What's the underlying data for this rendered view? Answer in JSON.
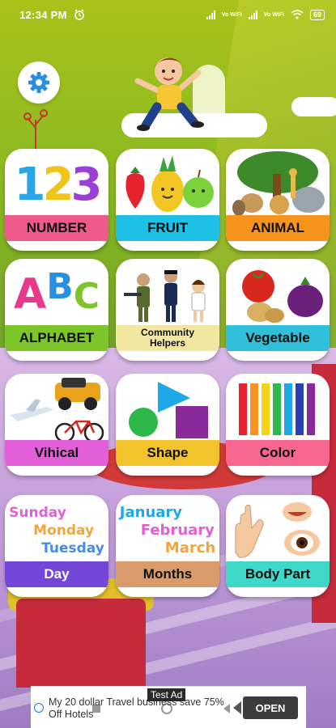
{
  "status_bar": {
    "time": "12:34 PM",
    "network_1": "Vo WiFi",
    "network_2": "Vo WiFi",
    "battery": "69"
  },
  "header": {
    "settings_icon": "gear-icon"
  },
  "categories": [
    {
      "label": "NUMBER",
      "art": "123",
      "color": "#f05a8a"
    },
    {
      "label": "FRUIT",
      "art": "fruits",
      "color": "#1ec0e6"
    },
    {
      "label": "ANIMAL",
      "art": "animals",
      "color": "#f7941d"
    },
    {
      "label": "ALPHABET",
      "art": "ABC",
      "color": "#7dc62a"
    },
    {
      "label": "Community Helpers",
      "label_line1": "Community",
      "label_line2": "Helpers",
      "art": "helpers",
      "color": "#f2e7a0"
    },
    {
      "label": "Vegetable",
      "art": "vegetables",
      "color": "#2fbfd8"
    },
    {
      "label": "Vihical",
      "art": "vehicles",
      "color": "#e25fd9"
    },
    {
      "label": "Shape",
      "art": "shapes",
      "color": "#f3c32c"
    },
    {
      "label": "Color",
      "art": "stripes",
      "color": "#f7668f"
    },
    {
      "label": "Day",
      "art": "days",
      "color": "#7345d8",
      "days": [
        "Sunday",
        "Monday",
        "Tuesday"
      ]
    },
    {
      "label": "Months",
      "art": "months",
      "color": "#d99a6c",
      "months": [
        "January",
        "February",
        "March"
      ]
    },
    {
      "label": "Body Part",
      "art": "body",
      "color": "#3ed8c9"
    }
  ],
  "ad": {
    "badge": "Test Ad",
    "text": "My 20 dollar Travel business save 75% Off Hotels",
    "cta": "OPEN"
  }
}
